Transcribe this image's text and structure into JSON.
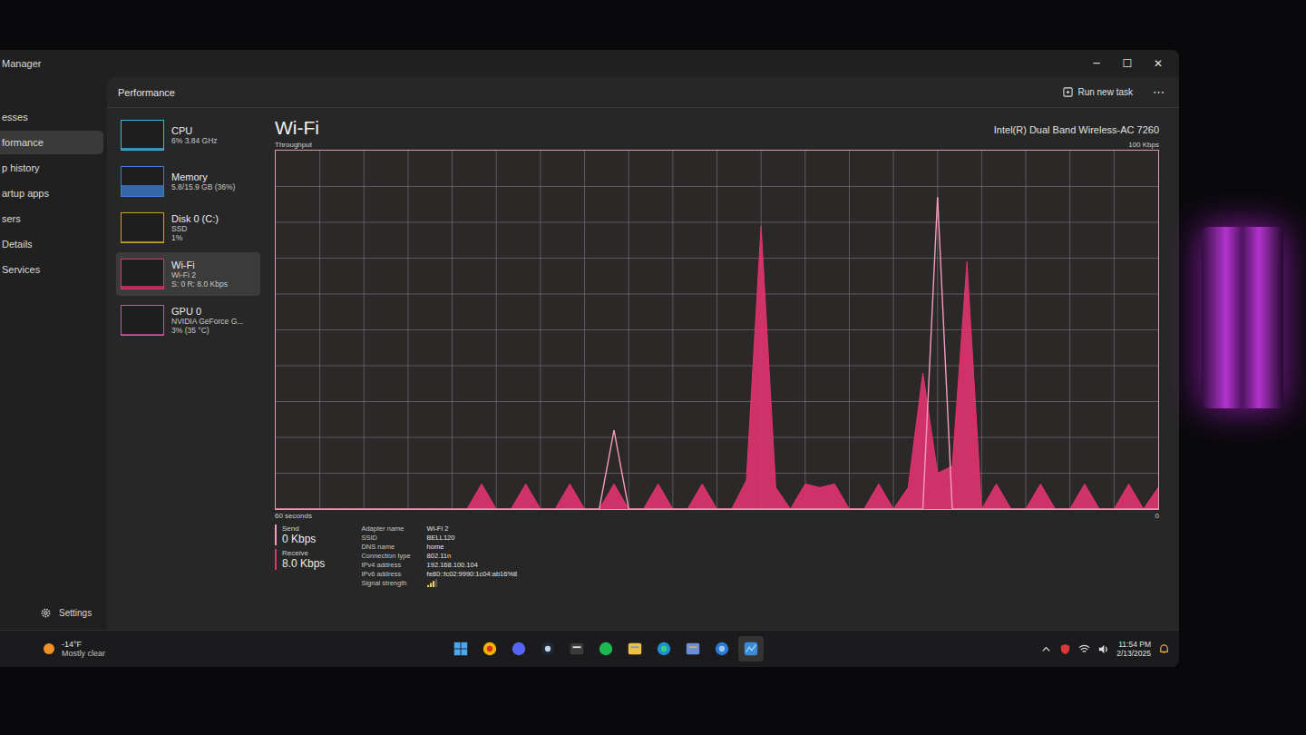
{
  "window": {
    "title": "Manager",
    "controls": [
      "─",
      "☐",
      "✕"
    ]
  },
  "nav": {
    "items": [
      {
        "label": "esses",
        "selected": false
      },
      {
        "label": "formance",
        "selected": true
      },
      {
        "label": "p history",
        "selected": false
      },
      {
        "label": "artup apps",
        "selected": false
      },
      {
        "label": "sers",
        "selected": false
      },
      {
        "label": "Details",
        "selected": false
      },
      {
        "label": "Services",
        "selected": false
      }
    ],
    "settings": "Settings"
  },
  "header": {
    "title": "Performance",
    "run_task": "Run new task",
    "more": "⋯"
  },
  "resources": [
    {
      "name": "CPU",
      "lines": [
        "6% 3.84 GHz"
      ],
      "level": 0.06,
      "color": "#3fb6d8",
      "selected": false
    },
    {
      "name": "Memory",
      "lines": [
        "5.8/15.9 GB (36%)"
      ],
      "level": 0.36,
      "color": "#3d7fd9",
      "selected": false
    },
    {
      "name": "Disk 0 (C:)",
      "lines": [
        "SSD",
        "1%"
      ],
      "level": 0.01,
      "color": "#c9a227",
      "selected": false
    },
    {
      "name": "Wi-Fi",
      "lines": [
        "Wi-Fi 2",
        "S: 0 R: 8.0 Kbps"
      ],
      "level": 0.08,
      "color": "#e0336f",
      "selected": true
    },
    {
      "name": "GPU 0",
      "lines": [
        "NVIDIA GeForce G...",
        "3% (35 °C)"
      ],
      "level": 0.03,
      "color": "#c95aa0",
      "selected": false
    }
  ],
  "detail": {
    "title": "Wi-Fi",
    "adapter": "Intel(R) Dual Band Wireless-AC 7260",
    "chart": {
      "title": "Throughput",
      "max_label": "100 Kbps",
      "time_label": "60 seconds",
      "min_label": "0",
      "series": [
        {
          "name": "Receive",
          "reading": "8.0 Kbps",
          "kind": "area",
          "color": "#e0336f",
          "values": [
            0,
            0,
            0,
            0,
            0,
            0,
            0,
            0,
            0,
            0,
            0,
            0,
            0,
            0,
            7,
            0,
            0,
            7,
            0,
            0,
            7,
            0,
            0,
            7,
            0,
            0,
            7,
            0,
            0,
            7,
            0,
            0,
            8,
            79,
            6,
            0,
            7,
            6,
            7,
            0,
            0,
            7,
            0,
            6,
            38,
            10,
            12,
            69,
            0,
            7,
            0,
            0,
            7,
            0,
            0,
            7,
            0,
            0,
            7,
            0,
            6
          ]
        },
        {
          "name": "Send",
          "reading": "0 Kbps",
          "kind": "line",
          "color": "#f59bbb",
          "values": [
            0,
            0,
            0,
            0,
            0,
            0,
            0,
            0,
            0,
            0,
            0,
            0,
            0,
            0,
            0,
            0,
            0,
            0,
            0,
            0,
            0,
            0,
            0,
            22,
            0,
            0,
            0,
            0,
            0,
            0,
            0,
            0,
            0,
            0,
            0,
            0,
            0,
            0,
            0,
            0,
            0,
            0,
            0,
            0,
            0,
            87,
            0,
            0,
            0,
            0,
            0,
            0,
            0,
            0,
            0,
            0,
            0,
            0,
            0,
            0,
            0
          ]
        }
      ]
    },
    "properties": [
      {
        "label": "Adapter name",
        "value": "Wi-Fi 2"
      },
      {
        "label": "SSID",
        "value": "BELL120"
      },
      {
        "label": "DNS name",
        "value": "home"
      },
      {
        "label": "Connection type",
        "value": "802.11n"
      },
      {
        "label": "IPv4 address",
        "value": "192.168.100.104"
      },
      {
        "label": "IPv6 address",
        "value": "fe80::fc02:9990:1c04:ab16%8"
      }
    ],
    "signal": {
      "label": "Signal strength",
      "level": 0.75
    }
  },
  "taskbar": {
    "weather": {
      "temp": "-14°F",
      "condition": "Mostly clear"
    },
    "time": "11:54 PM",
    "date": "2/13/2025"
  }
}
